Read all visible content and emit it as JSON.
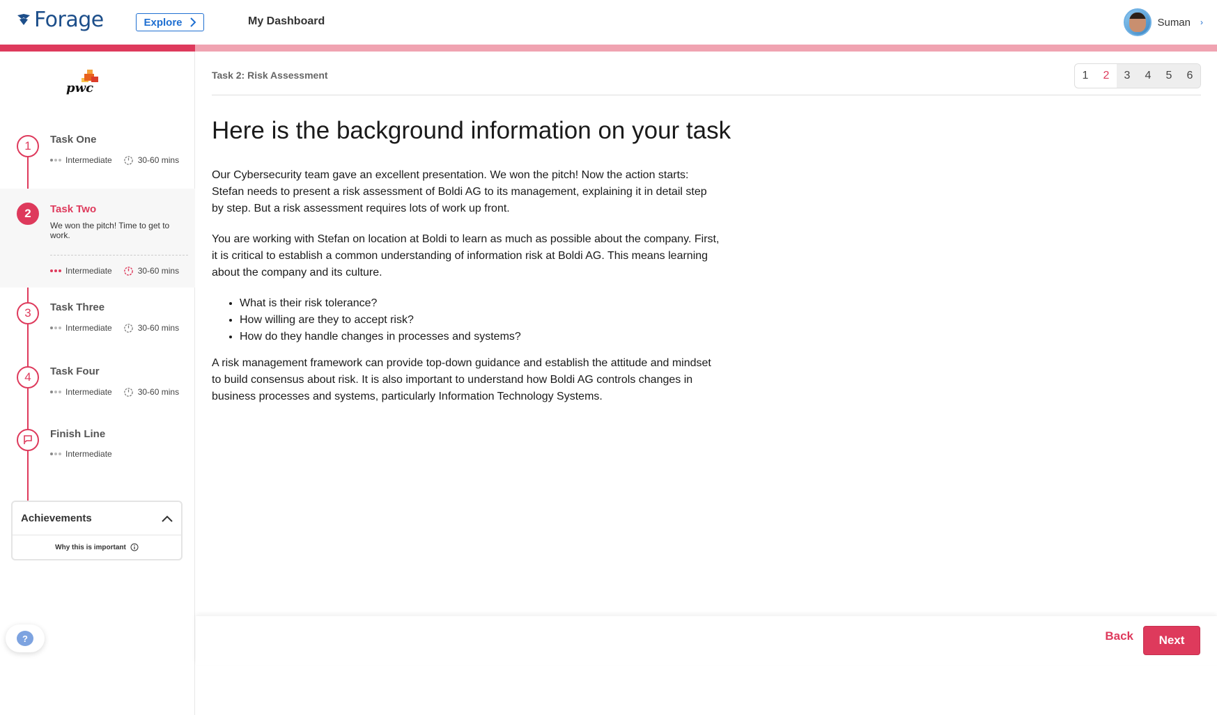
{
  "nav": {
    "logo_text": "Forage",
    "explore_label": "Explore",
    "dashboard_label": "My Dashboard",
    "user_name": "Suman"
  },
  "progress": {
    "fraction": 0.16
  },
  "sidebar": {
    "company_logo": "pwc",
    "tasks": [
      {
        "number": "1",
        "title": "Task One",
        "level": "Intermediate",
        "duration": "30-60 mins",
        "active": false
      },
      {
        "number": "2",
        "title": "Task Two",
        "description": "We won the pitch! Time to get to work.",
        "level": "Intermediate",
        "duration": "30-60 mins",
        "active": true
      },
      {
        "number": "3",
        "title": "Task Three",
        "level": "Intermediate",
        "duration": "30-60 mins",
        "active": false
      },
      {
        "number": "4",
        "title": "Task Four",
        "level": "Intermediate",
        "duration": "30-60 mins",
        "active": false
      },
      {
        "number": "",
        "title": "Finish Line",
        "level": "Intermediate",
        "active": false
      }
    ],
    "achievements": {
      "title": "Achievements",
      "why_label": "Why this is important"
    },
    "help_label": "?"
  },
  "main": {
    "breadcrumb": "Task 2: Risk Assessment",
    "pages": [
      "1",
      "2",
      "3",
      "4",
      "5",
      "6"
    ],
    "current_page": "2",
    "heading": "Here is the background information on your task",
    "paragraphs": [
      "Our Cybersecurity team gave an excellent presentation. We won the pitch! Now the action starts: Stefan needs to present a risk assessment of Boldi AG to its management, explaining it in detail step by step. But a risk assessment requires lots of work up front.",
      "You are working with Stefan on location at Boldi to learn as much as possible about the company. First, it is critical to establish a common understanding of information risk at Boldi AG. This means learning about the company and its culture."
    ],
    "bullets": [
      "What is their risk tolerance?",
      "How willing are they to accept risk?",
      "How do they handle changes in processes and systems?"
    ],
    "closing_paragraph": "A risk management framework can provide top-down guidance and establish the attitude and mindset to build consensus about risk. It is also important to understand how Boldi AG controls changes in business processes and systems, particularly Information Technology Systems."
  },
  "actions": {
    "back_label": "Back",
    "next_label": "Next"
  },
  "colors": {
    "accent": "#de3a5c",
    "brand": "#1c4e8a",
    "link": "#1f6fd1"
  }
}
